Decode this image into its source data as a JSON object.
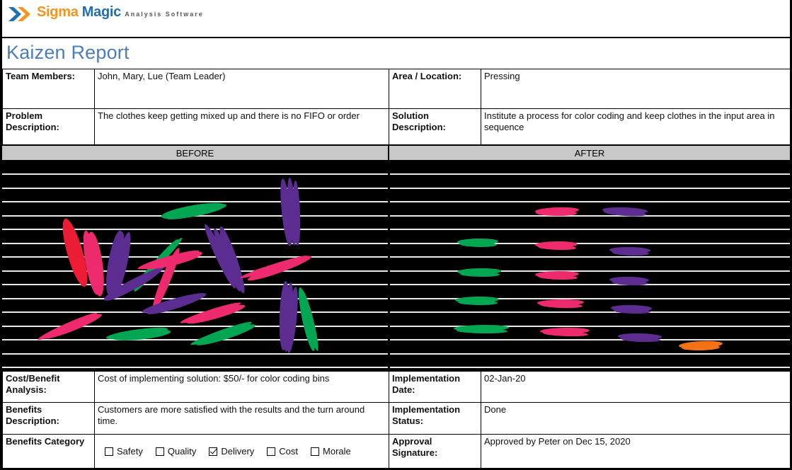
{
  "brand": {
    "name_part1": "Sigma",
    "name_part2": "Magic",
    "tagline": "Analysis Software",
    "colors": {
      "orange": "#f7931e",
      "blue": "#1f6fb4",
      "gray": "#58595b"
    }
  },
  "page_title": "Kaizen Report",
  "title_color": "#4a7ebb",
  "top_rows": [
    {
      "left_label": "Team Members:",
      "left_value": "John, Mary, Lue (Team Leader)",
      "right_label": "Area / Location:",
      "right_value": "Pressing"
    },
    {
      "left_label": "Problem Description:",
      "left_value": "The clothes keep getting mixed up and there is no FIFO or order",
      "right_label": "Solution Description:",
      "right_value": "Institute a process for color coding and keep clothes in the input area in sequence"
    }
  ],
  "compare_band": {
    "before_label": "BEFORE",
    "after_label": "AFTER",
    "band_bg": "#c8c8c8"
  },
  "photos": {
    "background": "#000000",
    "rail_color": "#e8e8e8",
    "rail_count": 15,
    "item_colors": {
      "pink": "#ee2a6e",
      "green": "#00a651",
      "purple": "#5c2d91",
      "red": "#ed1c35",
      "orange": "#f47216"
    },
    "before_caption": "Clothes hung in random order and orientation, colors mixed",
    "after_caption": "Clothes sorted by color into neat horizontal rows"
  },
  "bottom_rows": [
    {
      "left_label": "Cost/Benefit Analysis:",
      "left_value": "Cost of implementing solution: $50/- for color coding bins",
      "right_label": "Implementation Date:",
      "right_value": "02-Jan-20"
    },
    {
      "left_label": "Benefits Description:",
      "left_value": "Customers are more satisfied with the results and the turn around time.",
      "right_label": "Implementation Status:",
      "right_value": "Done"
    }
  ],
  "benefits_category": {
    "label": "Benefits Category",
    "options": [
      {
        "label": "Safety",
        "checked": false
      },
      {
        "label": "Quality",
        "checked": false
      },
      {
        "label": "Delivery",
        "checked": true
      },
      {
        "label": "Cost",
        "checked": false
      },
      {
        "label": "Morale",
        "checked": false
      }
    ]
  },
  "approval": {
    "label": "Approval Signature:",
    "value": "Approved by Peter on Dec 15, 2020"
  }
}
